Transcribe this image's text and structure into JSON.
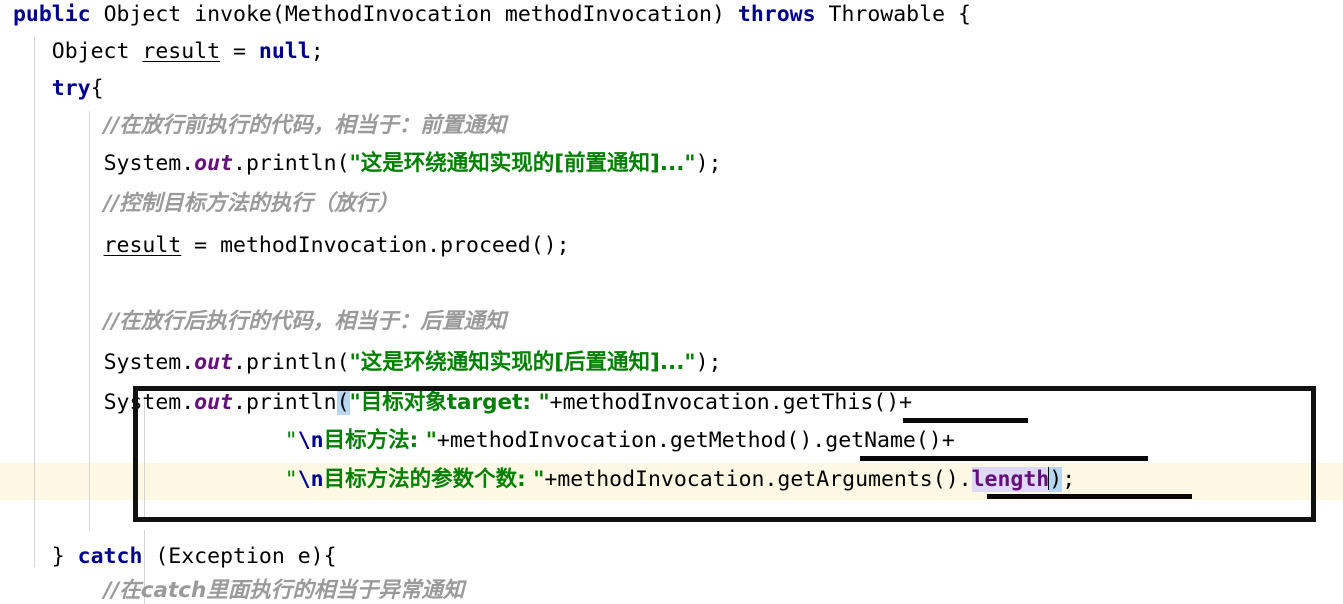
{
  "editor": {
    "language": "Java",
    "font_size_px": 21.5,
    "line_height_px": 37,
    "background": "#ffffff",
    "caret_line_background": "#fcf8e4",
    "indent_guide_color": "#d4d4d4",
    "selection_background": "#ddd9f7",
    "bracket_match_background": "#b7d7f0"
  },
  "colors": {
    "keyword": "#00008f",
    "string": "#008000",
    "comment": "#9a9a9a",
    "field": "#660e7a",
    "constant": "#660e7a",
    "plain_text": "#000000",
    "annotation_ink": "#111111"
  },
  "annotations": {
    "box_label": "highlighted-code-block",
    "underline_1_label": "getThis-underline",
    "underline_2_label": "getMethod-getName-underline",
    "underline_3_label": "getArguments-underline"
  },
  "code": {
    "line1": {
      "kw_public": "public",
      "sp1": " ",
      "type_object": "Object",
      "sp2": " ",
      "method": "invoke(",
      "param_type": "MethodInvocation",
      "sp3": " ",
      "param_name": "methodInvocation)",
      "sp4": " ",
      "kw_throws": "throws",
      "sp5": " ",
      "throwable": "Throwable",
      "sp6": " ",
      "brace": "{"
    },
    "line2": {
      "indent": "    ",
      "type": "Object",
      "sp1": " ",
      "var": "result",
      "sp2": " = ",
      "kw_null": "null",
      "semi": ";"
    },
    "line3": {
      "indent": "    ",
      "kw_try": "try",
      "brace": "{"
    },
    "line4": {
      "indent": "        ",
      "text": "//在放行前执行的代码，相当于：前置通知"
    },
    "line5": {
      "indent": "        ",
      "sysout_a": "System.",
      "field_out": "out",
      "sysout_b": ".println(",
      "string": "\"这是环绕通知实现的[前置通知]...\"",
      "tail": ");"
    },
    "line6": {
      "indent": "        ",
      "text": "//控制目标方法的执行（放行）"
    },
    "line7": {
      "indent": "        ",
      "var": "result",
      "mid": " = methodInvocation.proceed();"
    },
    "line8": {
      "indent": "        ",
      "text": "//在放行后执行的代码，相当于：后置通知"
    },
    "line9": {
      "indent": "        ",
      "sysout_a": "System.",
      "field_out": "out",
      "sysout_b": ".println(",
      "string": "\"这是环绕通知实现的[后置通知]...\"",
      "tail": ");"
    },
    "line10": {
      "indent": "        ",
      "sysout_a": "System.",
      "field_out": "out",
      "sysout_b": ".println",
      "open_paren": "(",
      "string": "\"目标对象target: \"",
      "tail": "+methodInvocation.getThis()+"
    },
    "line11": {
      "indent": "                      ",
      "quote_open": "\"",
      "escape": "\\n",
      "string": "目标方法: \"",
      "tail": "+methodInvocation.getMethod().getName()+"
    },
    "line12": {
      "indent": "                      ",
      "quote_open": "\"",
      "escape": "\\n",
      "string": "目标方法的参数个数: \"",
      "mid": "+methodInvocation.getArguments().",
      "length": "length",
      "close_paren": ")",
      "semi": ";"
    },
    "line13": {
      "indent": "    ",
      "close_brace": "} ",
      "kw_catch": "catch",
      "rest": " (Exception e){"
    },
    "line14": {
      "indent": "        ",
      "text": "//在catch里面执行的相当于异常通知"
    }
  }
}
